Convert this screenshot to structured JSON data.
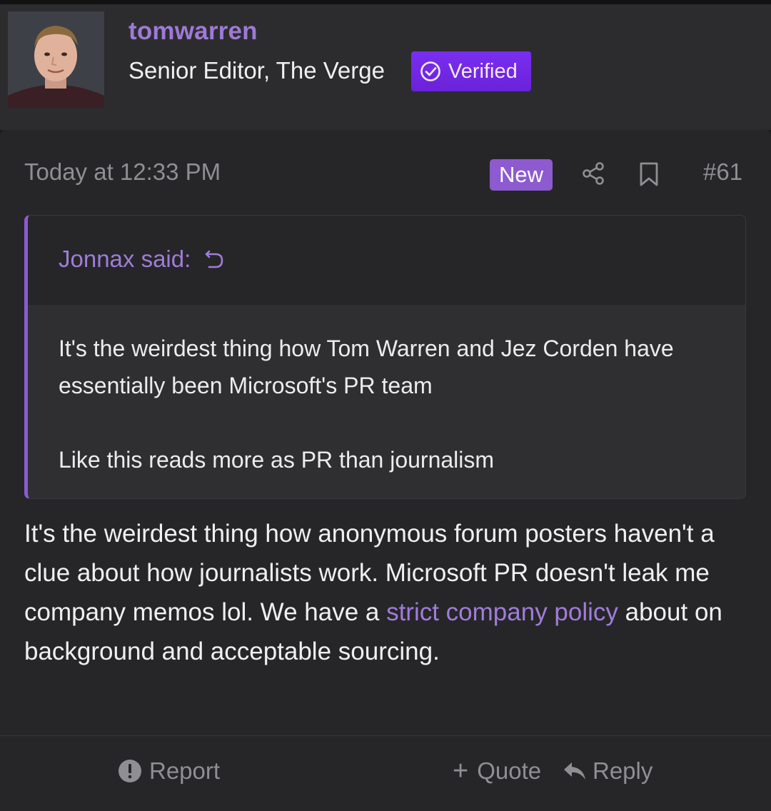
{
  "author": {
    "username": "tomwarren",
    "title": "Senior Editor, The Verge",
    "badge_label": "Verified"
  },
  "post": {
    "timestamp": "Today at 12:33 PM",
    "new_label": "New",
    "post_number": "#61",
    "quote": {
      "author_label": "Jonnax said:",
      "paragraphs": [
        "It's the weirdest thing how Tom Warren and Jez Corden have essentially been Microsoft's PR team",
        "Like this reads more as PR than journalism"
      ]
    },
    "message": {
      "text_before_link": "It's the weirdest thing how anonymous forum posters haven't a clue about how journalists work. Microsoft PR doesn't leak me company memos lol. We have a ",
      "link_text": "strict company policy",
      "text_after_link": " about on background and acceptable sourcing."
    }
  },
  "footer": {
    "report_label": "Report",
    "quote_label": "Quote",
    "reply_label": "Reply"
  },
  "icons": {
    "avatar": "user-avatar",
    "verified": "check-circle-icon",
    "share": "share-icon",
    "bookmark": "bookmark-icon",
    "quote_jump": "jump-back-icon",
    "report": "exclamation-circle-icon",
    "quote_plus": "plus-icon",
    "reply": "reply-arrow-icon"
  },
  "colors": {
    "accent": "#9d7ad6",
    "verified_bg": "#7a2ef0",
    "new_badge_bg": "#8d5ad0",
    "background": "#262628"
  }
}
